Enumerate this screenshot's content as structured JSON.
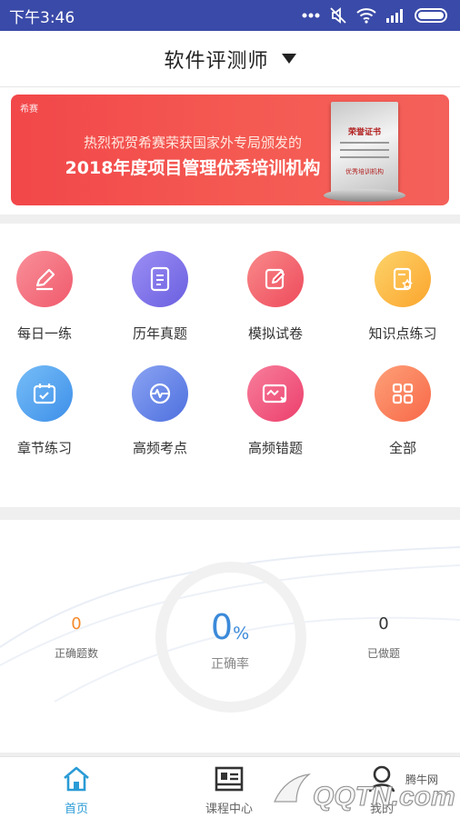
{
  "status_bar": {
    "time": "下午3:46"
  },
  "header": {
    "title": "软件评测师"
  },
  "banner": {
    "logo": "希赛",
    "line1": "热烈祝贺希赛荣获国家外专局颁发的",
    "line2": "2018年度项目管理优秀培训机构",
    "certificate_title": "荣誉证书",
    "certificate_footer": "优秀培训机构"
  },
  "grid": [
    {
      "label": "每日一练",
      "icon": "pencil-icon",
      "color": "#f36f7d"
    },
    {
      "label": "历年真题",
      "icon": "document-icon",
      "color": "#7f72e8"
    },
    {
      "label": "模拟试卷",
      "icon": "edit-paper-icon",
      "color": "#f45f69"
    },
    {
      "label": "知识点练习",
      "icon": "star-doc-icon",
      "color": "#fdb642"
    },
    {
      "label": "章节练习",
      "icon": "calendar-icon",
      "color": "#4ea3f1"
    },
    {
      "label": "高频考点",
      "icon": "wave-icon",
      "color": "#5f84e8"
    },
    {
      "label": "高频错题",
      "icon": "error-card-icon",
      "color": "#f2547a"
    },
    {
      "label": "全部",
      "icon": "grid-icon",
      "color": "#fa7a57"
    }
  ],
  "stats": {
    "correct_count": "0",
    "correct_count_label": "正确题数",
    "correct_rate": "0",
    "correct_rate_unit": "%",
    "correct_rate_label": "正确率",
    "done_count": "0",
    "done_count_label": "已做题"
  },
  "tabs": [
    {
      "label": "首页",
      "icon": "home-icon",
      "active": true,
      "color": "#2a9bd6"
    },
    {
      "label": "课程中心",
      "icon": "course-icon",
      "active": false,
      "color": "#666666"
    },
    {
      "label": "我的",
      "icon": "user-icon",
      "active": false,
      "color": "#666666"
    }
  ],
  "watermark": {
    "text": "QQTN.com",
    "subtext": "腾牛网"
  }
}
